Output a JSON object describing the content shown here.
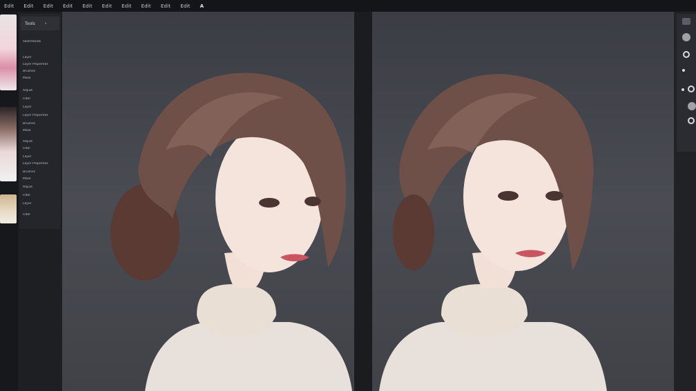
{
  "menubar": {
    "items": [
      "Edit",
      "Edit",
      "Edit",
      "Edit",
      "Edit",
      "Edit",
      "Edit",
      "Edit",
      "Edit",
      "Edit",
      "A"
    ]
  },
  "panel": {
    "title": "Tools",
    "arrow": "›",
    "lines": [
      "Sketchbook",
      "Layer",
      "Layer Properties",
      "Brushes",
      "Mask",
      "Adjust",
      "Filter",
      "Layer",
      "Layer Properties",
      "Brushes",
      "Mask",
      "Adjust",
      "Filter",
      "Layer",
      "Layer Properties",
      "Brushes",
      "Mask",
      "Adjust",
      "Filter",
      "Layer",
      "Filter"
    ]
  }
}
